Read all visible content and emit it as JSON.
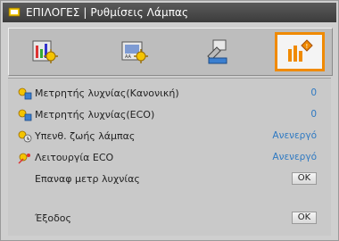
{
  "window": {
    "title": "ΕΠΙΛΟΓΕΣ | Ρυθμίσεις Λάμπας"
  },
  "tabs": [
    {
      "id": "image",
      "icon": "image-settings-icon"
    },
    {
      "id": "display",
      "icon": "display-settings-icon"
    },
    {
      "id": "setup",
      "icon": "setup-icon"
    },
    {
      "id": "options",
      "icon": "options-icon",
      "active": true
    }
  ],
  "rows": [
    {
      "label": "Μετρητής λυχνίας(Κανονική)",
      "value": "0",
      "icon": "lamp-hours-normal-icon"
    },
    {
      "label": "Μετρητής λυχνίας(ECO)",
      "value": "0",
      "icon": "lamp-hours-eco-icon"
    },
    {
      "label": "Υπενθ. ζωής λάμπας",
      "value": "Ανενεργό",
      "icon": "lamp-reminder-icon"
    },
    {
      "label": "Λειτουργία ECO",
      "value": "Ανενεργό",
      "icon": "eco-mode-icon"
    },
    {
      "label": "Επαναφ μετρ λυχνίας",
      "button": "OK"
    },
    {
      "label": "Έξοδος",
      "button": "OK"
    }
  ],
  "colors": {
    "accent": "#f08a00",
    "value": "#2e79c2",
    "title_bg": "#444444",
    "panel_bg": "#c9c9c9"
  }
}
